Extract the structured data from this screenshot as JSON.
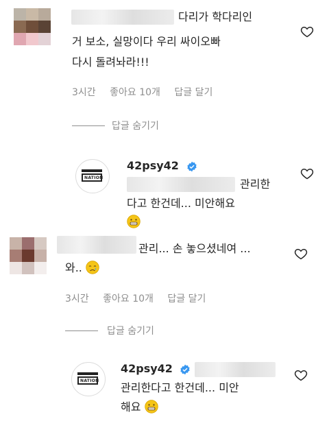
{
  "comments": [
    {
      "line1": "다리가 학다리인",
      "line2": "거 보소, 실망이다 우리 싸이오빠",
      "line3": "다시 돌려놔라!!!",
      "time": "3시간",
      "likes": "좋아요 10개",
      "reply": "답글 달기",
      "hide_replies": "답글 숨기기"
    },
    {
      "line1": "관리... 손 놓으셨네여 ...",
      "line2": "와..",
      "time": "3시간",
      "likes": "좋아요 10개",
      "reply": "답글 달기",
      "hide_replies": "답글 숨기기"
    }
  ],
  "replies": [
    {
      "username": "42psy42",
      "line1": "관리한",
      "line2": "다고 한건데... 미안해요",
      "avatar_label": "NATION"
    },
    {
      "username": "42psy42",
      "line1": "관리한다고 한건데... 미안",
      "line2": "해요",
      "avatar_label": "NATION"
    }
  ],
  "colors": {
    "text": "#262626",
    "meta": "#8e8e8e",
    "verified": "#3897f0",
    "emoji": "#f5c518"
  },
  "icons": [
    "heart-outline-icon",
    "verified-badge-icon",
    "grimacing-face-emoji",
    "crying-face-emoji"
  ]
}
